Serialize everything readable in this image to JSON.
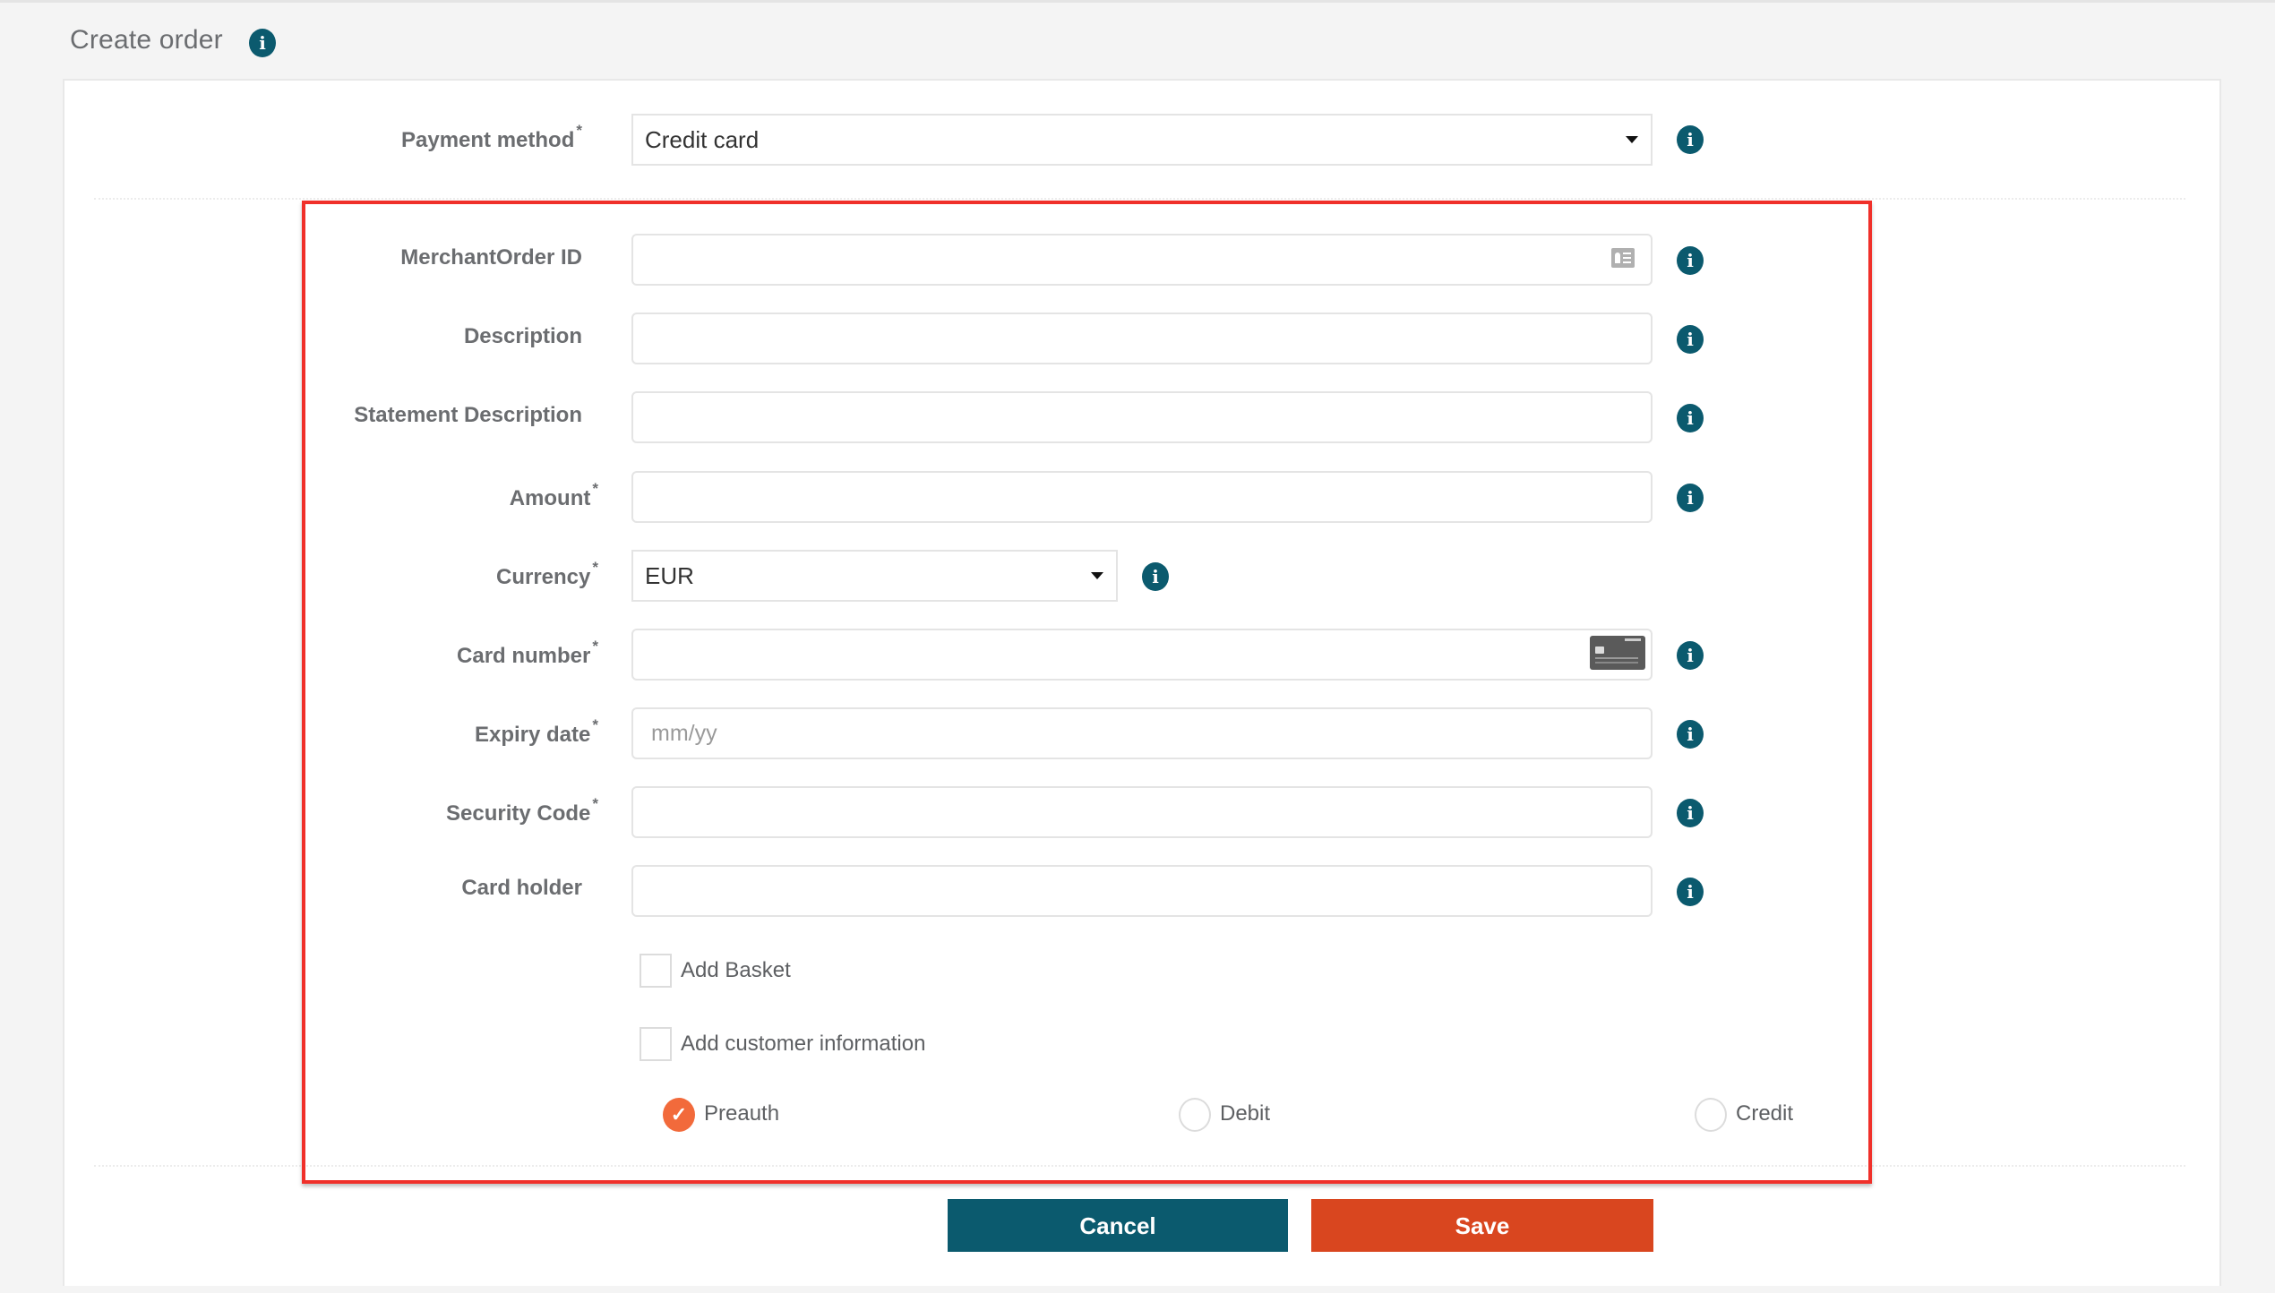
{
  "page": {
    "title": "Create order",
    "info_icon": "info-icon"
  },
  "payment_method": {
    "label": "Payment method",
    "required": "*",
    "value": "Credit card"
  },
  "fields": {
    "merchant_order_id": {
      "label": "MerchantOrder ID",
      "value": "",
      "icon": "id-card-icon"
    },
    "description": {
      "label": "Description",
      "value": ""
    },
    "statement_description": {
      "label": "Statement Description",
      "value": ""
    },
    "amount": {
      "label": "Amount",
      "required": "*",
      "value": ""
    },
    "currency": {
      "label": "Currency",
      "required": "*",
      "value": "EUR"
    },
    "card_number": {
      "label": "Card number",
      "required": "*",
      "value": "",
      "icon": "credit-card-icon"
    },
    "expiry_date": {
      "label": "Expiry date",
      "required": "*",
      "value": "",
      "placeholder": "mm/yy"
    },
    "security_code": {
      "label": "Security Code",
      "required": "*",
      "value": ""
    },
    "card_holder": {
      "label": "Card holder",
      "value": ""
    }
  },
  "checkboxes": {
    "add_basket": {
      "label": "Add Basket",
      "checked": false
    },
    "add_customer_info": {
      "label": "Add customer information",
      "checked": false
    }
  },
  "transaction_type": {
    "options": [
      {
        "label": "Preauth",
        "checked": true
      },
      {
        "label": "Debit",
        "checked": false
      },
      {
        "label": "Credit",
        "checked": false
      }
    ],
    "check_glyph": "✓"
  },
  "actions": {
    "cancel_label": "Cancel",
    "save_label": "Save"
  },
  "colors": {
    "primary": "#0b5a6e",
    "save": "#d9461f",
    "radio_checked": "#f26a3b",
    "highlight_box": "#f0302a"
  },
  "info_glyph": "i"
}
